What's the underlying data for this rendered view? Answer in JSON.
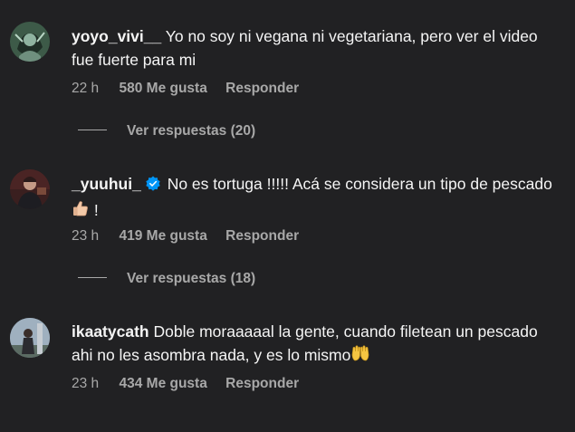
{
  "comments": [
    {
      "username": "yoyo_vivi__",
      "text": "Yo no soy ni vegana ni vegetariana, pero ver el video fue fuerte para mi",
      "verified": false,
      "time": "22 h",
      "likes": "580 Me gusta",
      "reply": "Responder",
      "view_replies": "Ver respuestas (20)"
    },
    {
      "username": "_yuuhui_",
      "text": "No es tortuga !!!!! Acá se considera un tipo de pescado",
      "text_suffix": "!",
      "verified": true,
      "time": "23 h",
      "likes": "419 Me gusta",
      "reply": "Responder",
      "view_replies": "Ver respuestas (18)"
    },
    {
      "username": "ikaatycath",
      "text": "Doble moraaaaal la gente, cuando filetean un pescado ahi no les asombra nada, y es lo mismo",
      "verified": false,
      "time": "23 h",
      "likes": "434 Me gusta",
      "reply": "Responder"
    }
  ],
  "icons": {
    "verified": "verified-badge-icon",
    "thumbs_up": "thumbs-up-emoji",
    "raised_hands": "raised-hands-emoji"
  },
  "colors": {
    "background": "#212123",
    "primary_text": "#f5f5f5",
    "secondary_text": "#a8a8a8",
    "verified_blue": "#0095f6"
  }
}
